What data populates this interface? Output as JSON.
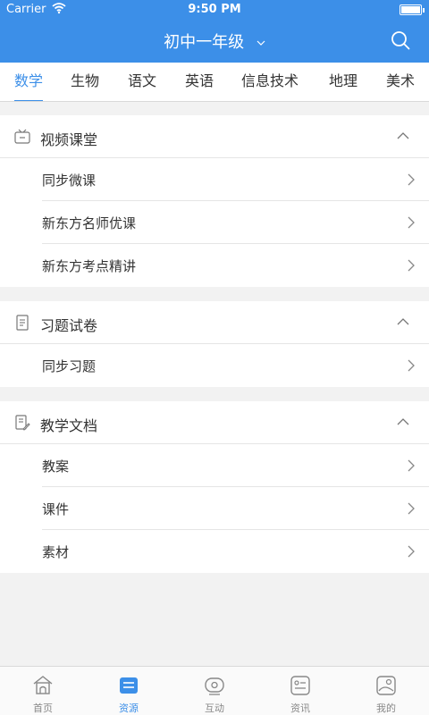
{
  "status_bar": {
    "carrier": "Carrier",
    "time": "9:50 PM"
  },
  "header": {
    "title": "初中一年级"
  },
  "tabs": [
    {
      "label": "数学",
      "active": true
    },
    {
      "label": "生物"
    },
    {
      "label": "语文"
    },
    {
      "label": "英语"
    },
    {
      "label": "信息技术"
    },
    {
      "label": "地理"
    },
    {
      "label": "美术"
    }
  ],
  "sections": [
    {
      "title": "视频课堂",
      "icon": "tv-icon",
      "items": [
        "同步微课",
        "新东方名师优课",
        "新东方考点精讲"
      ]
    },
    {
      "title": "习题试卷",
      "icon": "document-icon",
      "items": [
        "同步习题"
      ]
    },
    {
      "title": "教学文档",
      "icon": "doc-edit-icon",
      "items": [
        "教案",
        "课件",
        "素材"
      ]
    }
  ],
  "bottom_nav": [
    {
      "label": "首页",
      "icon": "home-icon"
    },
    {
      "label": "资源",
      "icon": "resource-icon",
      "active": true
    },
    {
      "label": "互动",
      "icon": "interact-icon"
    },
    {
      "label": "资讯",
      "icon": "news-icon"
    },
    {
      "label": "我的",
      "icon": "profile-icon"
    }
  ],
  "colors": {
    "accent": "#3c8fe8",
    "background": "#f2f2f2"
  }
}
